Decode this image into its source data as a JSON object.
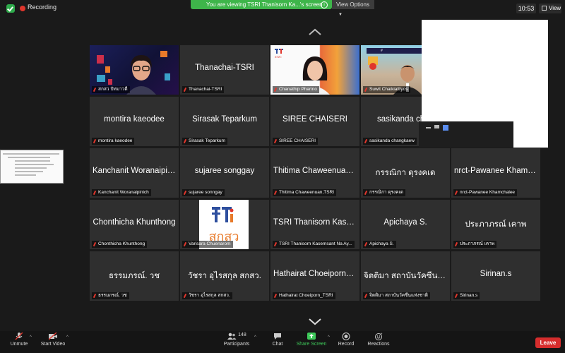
{
  "top": {
    "recording_label": "Recording",
    "share_banner": "You are viewing TSRI Thanisorn Ka...'s screen",
    "view_options": "View Options",
    "time": "10:53",
    "view_label": "View"
  },
  "tiles": [
    {
      "name_big": "",
      "label": "สกสว ปัทมาวดี",
      "kind": "video-a",
      "active": true
    },
    {
      "name_big": "Thanachai-TSRI",
      "label": "Thanachai-TSRI"
    },
    {
      "name_big": "",
      "label": "Chanathip Pharino",
      "kind": "video-b"
    },
    {
      "name_big": "",
      "label": "Suwit Chaikiattiyos",
      "kind": "video-c"
    },
    {
      "name_big": "",
      "label": "",
      "kind": "hidden"
    },
    {
      "name_big": "montira kaeodee",
      "label": "montira kaeodee"
    },
    {
      "name_big": "Sirasak Teparkum",
      "label": "Sirasak Teparkum"
    },
    {
      "name_big": "SIREE CHAISERI",
      "label": "SIREE CHAISERI"
    },
    {
      "name_big": "sasikanda chan",
      "label": "sasikanda changkaew"
    },
    {
      "name_big": "",
      "label": "",
      "kind": "hidden"
    },
    {
      "name_big": "Kanchanit Woranaipin...",
      "label": "Kanchanit Woranaipinich"
    },
    {
      "name_big": "sujaree songgay",
      "label": "sujaree sonngay"
    },
    {
      "name_big": "Thitima Chaweenuan,...",
      "label": "Thitima Chaweenuan,TSRI"
    },
    {
      "name_big": "กรรณิกา ดุรงคเด",
      "label": "กรรณิกา ดุรงคเด"
    },
    {
      "name_big": "nrct-Pawanee Khamc...",
      "label": "nrct-Pawanee Khamchalee"
    },
    {
      "name_big": "Chonthicha Khunthong",
      "label": "Chonthicha Khunthong"
    },
    {
      "name_big": "",
      "label": "Varisara Chuenarom",
      "kind": "logo"
    },
    {
      "name_big": "TSRI Thanisorn Kase...",
      "label": "TSRI Thanisorn Kasemsant Na Ay..."
    },
    {
      "name_big": "Apichaya S.",
      "label": "Apichaya S."
    },
    {
      "name_big": "ประภาภรณ์ เคาพ",
      "label": "ประภาภรณ์ เคาพ"
    },
    {
      "name_big": "ธรรมภรณ์. วช",
      "label": "ธรรมภรณ์. วช"
    },
    {
      "name_big": "วัชรา อุไรสกุล สกสว.",
      "label": "วัชรา อุไรสกุล สกสว."
    },
    {
      "name_big": "Hathairat Choeiporn_...",
      "label": "Hathairat Choeiporn_TSRI"
    },
    {
      "name_big": "จิตติมา สถาบันวัคซีนแ...",
      "label": "จิตติมา สถาบันวัคซีนแห่งชาติ"
    },
    {
      "name_big": "Sirinan.s",
      "label": "Sirinan.s"
    }
  ],
  "logo_text": "สกสว",
  "tsri_small": "สกสว",
  "toolbar": {
    "unmute": "Unmute",
    "start_video": "Start Video",
    "participants": "Participants",
    "participants_count": "148",
    "chat": "Chat",
    "share_screen": "Share Screen",
    "record": "Record",
    "reactions": "Reactions",
    "leave": "Leave"
  },
  "colors": {
    "share_green": "#3eb54a",
    "leave_red": "#d62d2d",
    "active_border": "#e3e36a",
    "tile_bg": "#2f2f2f"
  }
}
